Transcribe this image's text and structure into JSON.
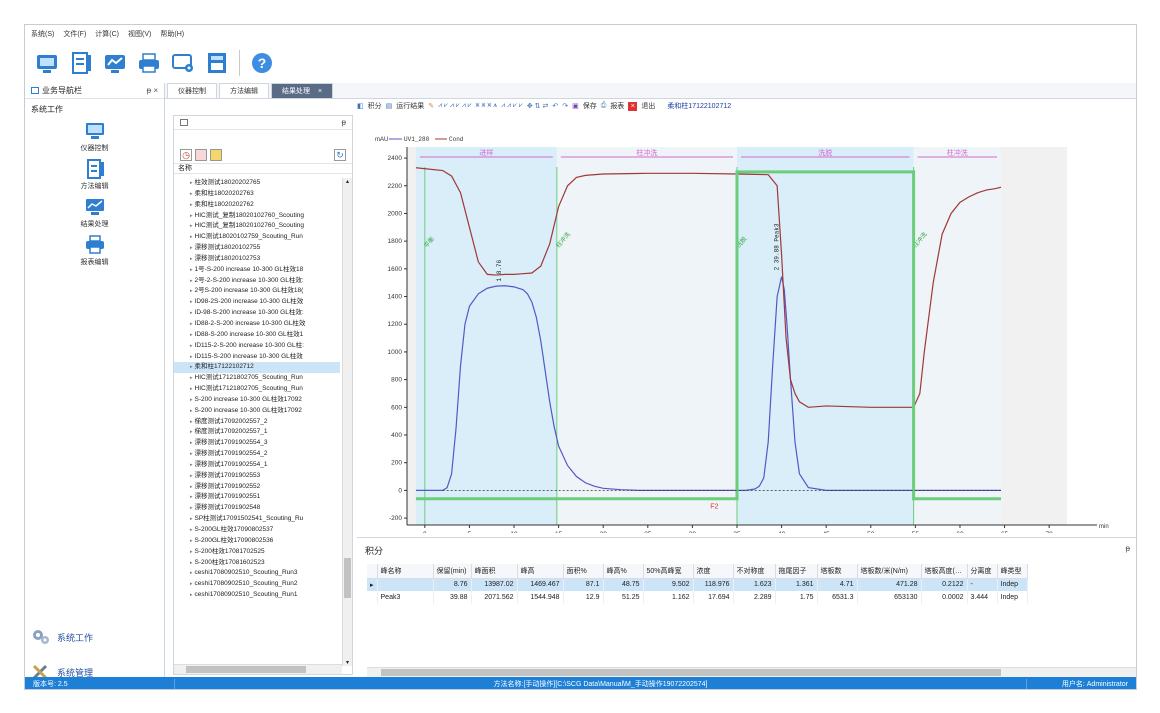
{
  "menu": [
    "系统(S)",
    "文件(F)",
    "计算(C)",
    "视图(V)",
    "帮助(H)"
  ],
  "toolbar_icons": [
    "instrument-icon",
    "method-icon",
    "results-icon",
    "print-icon",
    "settings-icon",
    "config-icon",
    "help-icon"
  ],
  "left_panel": {
    "title": "业务导航栏",
    "pin": "ᵽ ×",
    "section": "系统工作",
    "items": [
      {
        "label": "仪器控制",
        "icon": "monitor-icon"
      },
      {
        "label": "方法编辑",
        "icon": "method-icon"
      },
      {
        "label": "结果处理",
        "icon": "chart-icon"
      },
      {
        "label": "报表编辑",
        "icon": "printer-icon"
      }
    ],
    "bottom": [
      {
        "label": "系统工作",
        "icon": "gears-icon"
      },
      {
        "label": "系统管理",
        "icon": "tools-icon"
      }
    ]
  },
  "tabs": [
    {
      "label": "仪器控制",
      "active": false
    },
    {
      "label": "方法编辑",
      "active": false
    },
    {
      "label": "结果处理",
      "active": true
    }
  ],
  "tree": {
    "header": "名称",
    "items": [
      "柱效测试18020202765",
      "柔和柱18020202763",
      "柔和柱18020202762",
      "HIC测试_复制18020102760_Scouting",
      "HIC测试_复制18020102760_Scouting",
      "HIC测试18020102759_Scouting_Run",
      "漂移测试18020102755",
      "漂移测试18020102753",
      "1号-S-200 increase 10-300 GL柱效18",
      "2号-2-S-200 increase 10-300 GL柱效:",
      "2号S-200 increase 10-300 GL柱效18(",
      "ID98-2S-200 increase 10-300 GL柱效",
      "ID-98-S-200 increase 10-300 GL柱效:",
      "ID88-2-S-200 increase 10-300 GL柱效",
      "ID88-S-200 increase 10-300 GL柱效1",
      "ID115-2-S-200 increase 10-300 GL柱:",
      "ID115-S-200 increase 10-300 GL柱效",
      "柔和柱17122102712",
      "HIC测试17121802705_Scouting_Run",
      "HIC测试17121802705_Scouting_Run",
      "S-200 increase 10-300 GL柱效17092",
      "S-200 increase 10-300 GL柱效17092",
      "梯度测试17092002557_2",
      "梯度测试17092002557_1",
      "漂移测试17091902554_3",
      "漂移测试17091902554_2",
      "漂移测试17091902554_1",
      "漂移测试17091902553",
      "漂移测试17091902552",
      "漂移测试17091902551",
      "漂移测试17091902548",
      "SP柱测试17091502541_Scouting_Ru",
      "S-200GL柱效17090802537",
      "S-200GL柱效17090802536",
      "S-200柱效17081702525",
      "S-200柱效17081602523",
      "ceshi17080902510_Scouting_Run3",
      "ceshi17080902510_Scouting_Run2",
      "ceshi17080902510_Scouting_Run1"
    ],
    "selected_index": 17
  },
  "action_bar": {
    "integrate": "积分",
    "run_results": "运行结果",
    "save": "保存",
    "report": "报表",
    "exit": "退出",
    "current_file": "柔和柱17122102712"
  },
  "chart_data": {
    "type": "line",
    "ylabel": "mAU",
    "legend": [
      "UV1_280",
      "Cond"
    ],
    "xlabel": "min",
    "xlim": [
      -2,
      72
    ],
    "ylim": [
      -250,
      2480
    ],
    "x_ticks": [
      0,
      5,
      10,
      15,
      20,
      25,
      30,
      35,
      40,
      45,
      50,
      55,
      60,
      65,
      70
    ],
    "x_tick_labels": [
      "0",
      "5",
      "10",
      "15",
      "20",
      "25",
      "30",
      "35",
      "40",
      "45",
      "50",
      "55",
      "60",
      "65",
      "70"
    ],
    "y_ticks": [
      -200,
      0,
      200,
      400,
      600,
      800,
      1000,
      1200,
      1400,
      1600,
      1800,
      2000,
      2200,
      2400
    ],
    "phases": [
      {
        "name": "进样",
        "start": -1,
        "end": 14.8,
        "color": "#d9eef8"
      },
      {
        "name": "柱冲洗",
        "start": 14.8,
        "end": 35,
        "color": "#eef4f7"
      },
      {
        "name": "洗脱",
        "start": 35,
        "end": 54.8,
        "color": "#d9eef8"
      },
      {
        "name": "柱冲洗",
        "start": 54.8,
        "end": 64.6,
        "color": "#eef4f7"
      }
    ],
    "markers": [
      {
        "label": "平衡",
        "x": 0
      },
      {
        "label": "柱冲洗",
        "x": 14.8
      },
      {
        "label": "洗脱",
        "x": 35
      },
      {
        "label": "柱冲洗",
        "x": 54.8
      }
    ],
    "peak_labels": [
      {
        "label": "1 8.76",
        "x": 8.76,
        "y": 1480
      },
      {
        "label": "2 39.88 Peak3",
        "x": 39.88,
        "y": 1560
      }
    ],
    "frac_label": {
      "label": "F2",
      "x": 32,
      "y": -130
    },
    "series": [
      {
        "name": "UV1_280",
        "color": "#5656c8",
        "x": [
          -1,
          2,
          2.5,
          3,
          3.5,
          4,
          4.5,
          5,
          6,
          7,
          8,
          9,
          10,
          11,
          11.5,
          12,
          12.5,
          13,
          13.5,
          14,
          14.5,
          15,
          16,
          17,
          18,
          19,
          20,
          22,
          24,
          30,
          36,
          37,
          37.5,
          38,
          38.5,
          39,
          39.5,
          40,
          40.3,
          40.6,
          41,
          41.5,
          42,
          43,
          45,
          50,
          55,
          60,
          64.6
        ],
        "y": [
          0,
          0,
          20,
          120,
          450,
          900,
          1200,
          1330,
          1420,
          1460,
          1475,
          1478,
          1470,
          1450,
          1420,
          1360,
          1250,
          1080,
          860,
          640,
          460,
          320,
          180,
          100,
          55,
          30,
          15,
          5,
          0,
          0,
          0,
          10,
          30,
          90,
          350,
          900,
          1400,
          1544,
          1450,
          1200,
          800,
          350,
          120,
          20,
          0,
          0,
          0,
          0,
          0
        ]
      },
      {
        "name": "Cond",
        "color": "#a03838",
        "x": [
          -1,
          2,
          3,
          4,
          5,
          6,
          7,
          8,
          9,
          10,
          11,
          12,
          13,
          14,
          15,
          16,
          17,
          18,
          20,
          25,
          30,
          35,
          38.5,
          39.5,
          40,
          40.5,
          41,
          41.5,
          42,
          43,
          45,
          50,
          54.8,
          55.5,
          56,
          57,
          58,
          59,
          60,
          61,
          62,
          63,
          64,
          64.6
        ],
        "y": [
          2330,
          2310,
          2270,
          2150,
          1900,
          1650,
          1560,
          1555,
          1560,
          1560,
          1565,
          1570,
          1620,
          1780,
          2050,
          2200,
          2260,
          2275,
          2285,
          2290,
          2290,
          2285,
          2280,
          2200,
          1700,
          1100,
          800,
          700,
          640,
          600,
          610,
          600,
          600,
          700,
          1000,
          1500,
          1850,
          2000,
          2080,
          2120,
          2150,
          2170,
          2180,
          2190
        ]
      },
      {
        "name": "conc",
        "color": "#6cce7c",
        "x": [
          -1,
          35,
          35,
          54.8,
          54.8,
          64.6
        ],
        "y": [
          -60,
          -60,
          2300,
          2300,
          -60,
          -60
        ]
      }
    ]
  },
  "integration": {
    "title": "积分",
    "columns": [
      "峰名称",
      "保留(min)",
      "峰面积",
      "峰高",
      "面积%",
      "峰高%",
      "50%高峰宽",
      "浓度",
      "不对称度",
      "拖尾因子",
      "塔板数",
      "塔板数/米(N/m)",
      "塔板高度(…",
      "分离度",
      "峰类型"
    ],
    "rows": [
      [
        "",
        "8.76",
        "13987.02",
        "1469.467",
        "87.1",
        "48.75",
        "9.502",
        "118.976",
        "1.623",
        "1.361",
        "4.71",
        "471.28",
        "0.2122",
        "-",
        "Indep"
      ],
      [
        "Peak3",
        "39.88",
        "2071.562",
        "1544.948",
        "12.9",
        "51.25",
        "1.162",
        "17.694",
        "2.289",
        "1.75",
        "6531.3",
        "653130",
        "0.0002",
        "3.444",
        "Indep"
      ]
    ]
  },
  "status": {
    "version": "版本号: 2.5",
    "method": "方法名称:[手动操作][C:\\SCG Data\\Manual\\M_手动操作19072202574]",
    "user": "用户名:  Administrator"
  }
}
